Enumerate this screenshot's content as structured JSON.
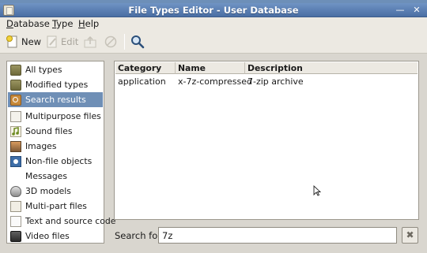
{
  "window": {
    "title": "File Types Editor - User Database",
    "minimize_glyph": "—",
    "close_glyph": "✕"
  },
  "menubar": {
    "items": [
      {
        "label": "Database",
        "accel": "D"
      },
      {
        "label": "Type",
        "accel": "T"
      },
      {
        "label": "Help",
        "accel": "H"
      }
    ]
  },
  "toolbar": {
    "new_label": "New",
    "edit_label": "Edit"
  },
  "sidebar": {
    "items": [
      {
        "label": "All types",
        "icon": "folder-icon",
        "selected": false
      },
      {
        "label": "Modified types",
        "icon": "folder-icon",
        "selected": false
      },
      {
        "label": "Search results",
        "icon": "search-folder-icon",
        "selected": true
      },
      {
        "label": "Multipurpose files",
        "icon": "document-icon",
        "selected": false
      },
      {
        "label": "Sound files",
        "icon": "sound-icon",
        "selected": false
      },
      {
        "label": "Images",
        "icon": "image-icon",
        "selected": false
      },
      {
        "label": "Non-file objects",
        "icon": "non-file-icon",
        "selected": false
      },
      {
        "label": "Messages",
        "icon": "",
        "selected": false
      },
      {
        "label": "3D models",
        "icon": "3d-model-icon",
        "selected": false
      },
      {
        "label": "Multi-part files",
        "icon": "multipart-icon",
        "selected": false
      },
      {
        "label": "Text and source code",
        "icon": "text-icon",
        "selected": false
      },
      {
        "label": "Video files",
        "icon": "video-icon",
        "selected": false
      }
    ]
  },
  "table": {
    "columns": [
      "Category",
      "Name",
      "Description"
    ],
    "rows": [
      [
        "application",
        "x-7z-compressed",
        "7-zip archive"
      ]
    ]
  },
  "search": {
    "label": "Search for:",
    "value": "7z",
    "clear_glyph": "✖"
  },
  "colors": {
    "titlebar": "#5b7fb3",
    "selection": "#6f8fb6",
    "window_bg": "#ece9e2"
  }
}
